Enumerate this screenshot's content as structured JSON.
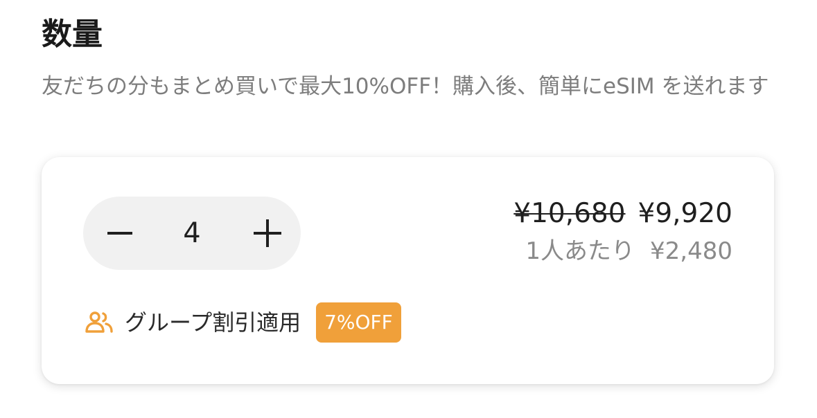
{
  "section": {
    "title": "数量",
    "subtitle": "友だちの分もまとめ買いで最大10%OFF！購入後、簡単にeSIM を送れます"
  },
  "stepper": {
    "quantity": "4",
    "minus_icon": "minus-icon",
    "plus_icon": "plus-icon"
  },
  "pricing": {
    "original_price": "¥10,680",
    "discounted_price": "¥9,920",
    "per_person_label": "1人あたり",
    "per_person_price": "¥2,480"
  },
  "discount": {
    "icon": "group-icon",
    "label": "グループ割引適用",
    "badge": "7%OFF"
  },
  "colors": {
    "accent": "#f0a03a",
    "text_primary": "#1f1f1f",
    "text_secondary": "#8a8a8a",
    "stepper_bg": "#f1f1f1"
  }
}
